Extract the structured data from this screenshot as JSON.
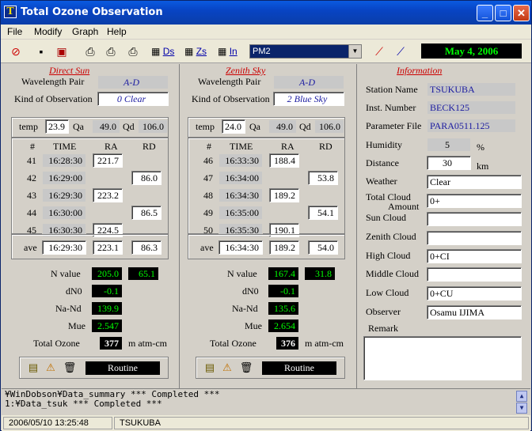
{
  "window": {
    "title": "Total Ozone Observation",
    "logo": "T"
  },
  "menu": [
    "File",
    "Modify",
    "Graph",
    "Help"
  ],
  "toolbar": {
    "ds_label": "Ds",
    "zs_label": "Zs",
    "in_label": "In",
    "instrument_select": "PM2",
    "date": "May  4, 2006"
  },
  "direct_sun": {
    "title": "Direct Sun",
    "wavelength_label": "Wavelength Pair",
    "wavelength_value": "A-D",
    "kind_label": "Kind of Observation",
    "kind_value": "0 Clear",
    "temp_label": "temp",
    "temp": "23.9",
    "qa_label": "Qa",
    "qa": "49.0",
    "qd_label": "Qd",
    "qd": "106.0",
    "col_num": "#",
    "col_time": "TIME",
    "col_ra": "RA",
    "col_rd": "RD",
    "rows": [
      {
        "n": "41",
        "time": "16:28:30",
        "ra": "221.7",
        "rd": ""
      },
      {
        "n": "42",
        "time": "16:29:00",
        "ra": "",
        "rd": "86.0"
      },
      {
        "n": "43",
        "time": "16:29:30",
        "ra": "223.2",
        "rd": ""
      },
      {
        "n": "44",
        "time": "16:30:00",
        "ra": "",
        "rd": "86.5"
      },
      {
        "n": "45",
        "time": "16:30:30",
        "ra": "224.5",
        "rd": ""
      }
    ],
    "ave_label": "ave",
    "ave_time": "16:29:30",
    "ave_ra": "223.1",
    "ave_rd": "86.3",
    "nvalue_label": "N value",
    "nvalue_1": "205.0",
    "nvalue_2": "65.1",
    "dn0_label": "dN0",
    "dn0": "-0.1",
    "nand_label": "Na-Nd",
    "nand": "139.9",
    "mue_label": "Mue",
    "mue": "2.547",
    "total_label": "Total Ozone",
    "total": "377",
    "unit": "m atm-cm",
    "mode": "Routine"
  },
  "zenith_sky": {
    "title": "Zenith Sky",
    "wavelength_label": "Wavelength Pair",
    "wavelength_value": "A-D",
    "kind_label": "Kind of Observation",
    "kind_value": "2 Blue Sky",
    "temp_label": "temp",
    "temp": "24.0",
    "qa_label": "Qa",
    "qa": "49.0",
    "qd_label": "Qd",
    "qd": "106.0",
    "col_num": "#",
    "col_time": "TIME",
    "col_ra": "RA",
    "col_rd": "RD",
    "rows": [
      {
        "n": "46",
        "time": "16:33:30",
        "ra": "188.4",
        "rd": ""
      },
      {
        "n": "47",
        "time": "16:34:00",
        "ra": "",
        "rd": "53.8"
      },
      {
        "n": "48",
        "time": "16:34:30",
        "ra": "189.2",
        "rd": ""
      },
      {
        "n": "49",
        "time": "16:35:00",
        "ra": "",
        "rd": "54.1"
      },
      {
        "n": "50",
        "time": "16:35:30",
        "ra": "190.1",
        "rd": ""
      }
    ],
    "ave_label": "ave",
    "ave_time": "16:34:30",
    "ave_ra": "189.2",
    "ave_rd": "54.0",
    "nvalue_label": "N value",
    "nvalue_1": "167.4",
    "nvalue_2": "31.8",
    "dn0_label": "dN0",
    "dn0": "-0.1",
    "nand_label": "Na-Nd",
    "nand": "135.6",
    "mue_label": "Mue",
    "mue": "2.654",
    "total_label": "Total Ozone",
    "total": "376",
    "unit": "m atm-cm",
    "mode": "Routine"
  },
  "information": {
    "title": "Information",
    "station_label": "Station Name",
    "station": "TSUKUBA",
    "inst_label": "Inst. Number",
    "inst": "BECK125",
    "param_label": "Parameter File",
    "param": "PARA0511.125",
    "humidity_label": "Humidity",
    "humidity": "5",
    "humidity_unit": "%",
    "distance_label": "Distance",
    "distance": "30",
    "distance_unit": "km",
    "weather_label": "Weather",
    "weather": "Clear",
    "total_cloud_label_1": "Total Cloud",
    "total_cloud_label_2": "Amount",
    "total_cloud": "0+",
    "sun_cloud_label": "Sun Cloud",
    "sun_cloud": "",
    "zenith_cloud_label": "Zenith Cloud",
    "zenith_cloud": "",
    "high_cloud_label": "High Cloud",
    "high_cloud": "0+CI",
    "middle_cloud_label": "Middle Cloud",
    "middle_cloud": "",
    "low_cloud_label": "Low Cloud",
    "low_cloud": "0+CU",
    "observer_label": "Observer",
    "observer": "Osamu IJIMA",
    "remark_label": "Remark",
    "remark": ""
  },
  "log": [
    "¥WinDobson¥Data_summary  *** Completed ***",
    "1:¥Data_tsuk  *** Completed ***"
  ],
  "status": {
    "datetime": "2006/05/10 13:25:48",
    "station": "TSUKUBA"
  }
}
